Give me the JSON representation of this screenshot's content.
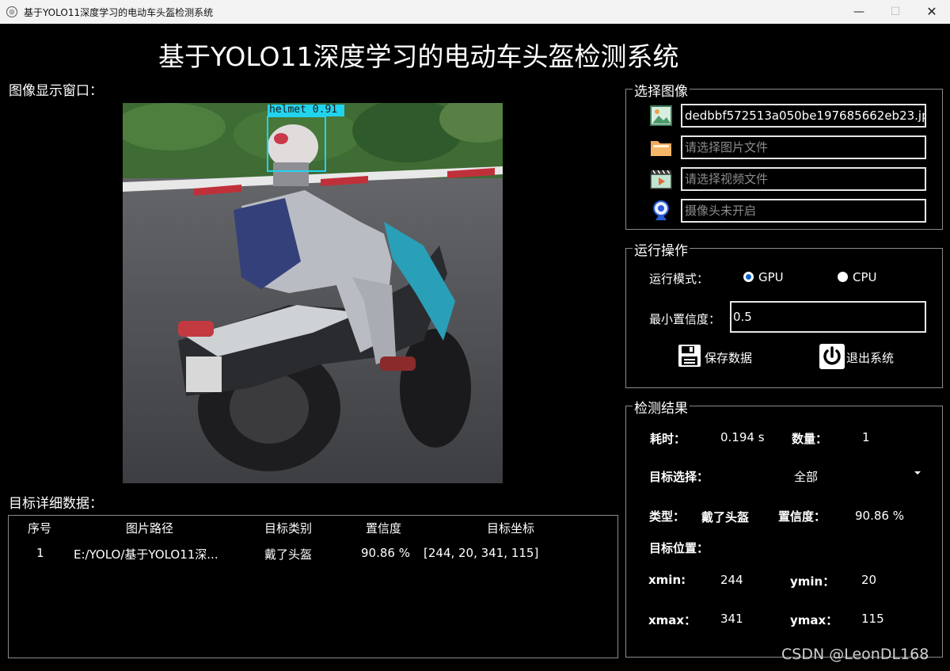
{
  "window": {
    "title": "基于YOLO11深度学习的电动车头盔检测系统",
    "app_icon": "logo-icon",
    "min_glyph": "—",
    "max_glyph": "☐",
    "close_glyph": "✕"
  },
  "main_title": "基于YOLO11深度学习的电动车头盔检测系统",
  "image_panel": {
    "label": "图像显示窗口：",
    "detection_label": "helmet  0.91",
    "box_color": "#22d3ee"
  },
  "table": {
    "label": "目标详细数据：",
    "headers": [
      "序号",
      "图片路径",
      "目标类别",
      "置信度",
      "目标坐标"
    ],
    "rows": [
      {
        "index": "1",
        "path": "E:/YOLO/基于YOLO11深...",
        "class": "戴了头盔",
        "confidence": "90.86 %",
        "coords": "[244, 20, 341, 115]"
      }
    ]
  },
  "select_image": {
    "title": "选择图像",
    "image_value": "dedbbf572513a050be197685662eb23.jpg",
    "folder_placeholder": "请选择图片文件",
    "video_placeholder": "请选择视频文件",
    "camera_placeholder": "摄像头未开启",
    "icons": [
      "image-icon",
      "folder-icon",
      "video-icon",
      "camera-icon"
    ]
  },
  "operations": {
    "title": "运行操作",
    "mode_label": "运行模式：",
    "mode_gpu": "GPU",
    "mode_cpu": "CPU",
    "mode_selected": "GPU",
    "conf_label": "最小置信度：",
    "conf_value": "0.5",
    "save_label": "保存数据",
    "exit_label": "退出系统"
  },
  "results": {
    "title": "检测结果",
    "time_label": "耗时：",
    "time_value": "0.194 s",
    "count_label": "数量：",
    "count_value": "1",
    "target_select_label": "目标选择：",
    "target_select_value": "全部",
    "type_label": "类型：",
    "type_value": "戴了头盔",
    "conf_label": "置信度：",
    "conf_value": "90.86 %",
    "position_label": "目标位置：",
    "xmin_label": "xmin:",
    "xmin_value": "244",
    "ymin_label": "ymin：",
    "ymin_value": "20",
    "xmax_label": "xmax：",
    "xmax_value": "341",
    "ymax_label": "ymax：",
    "ymax_value": "115"
  },
  "watermark": "CSDN @LeonDL168"
}
